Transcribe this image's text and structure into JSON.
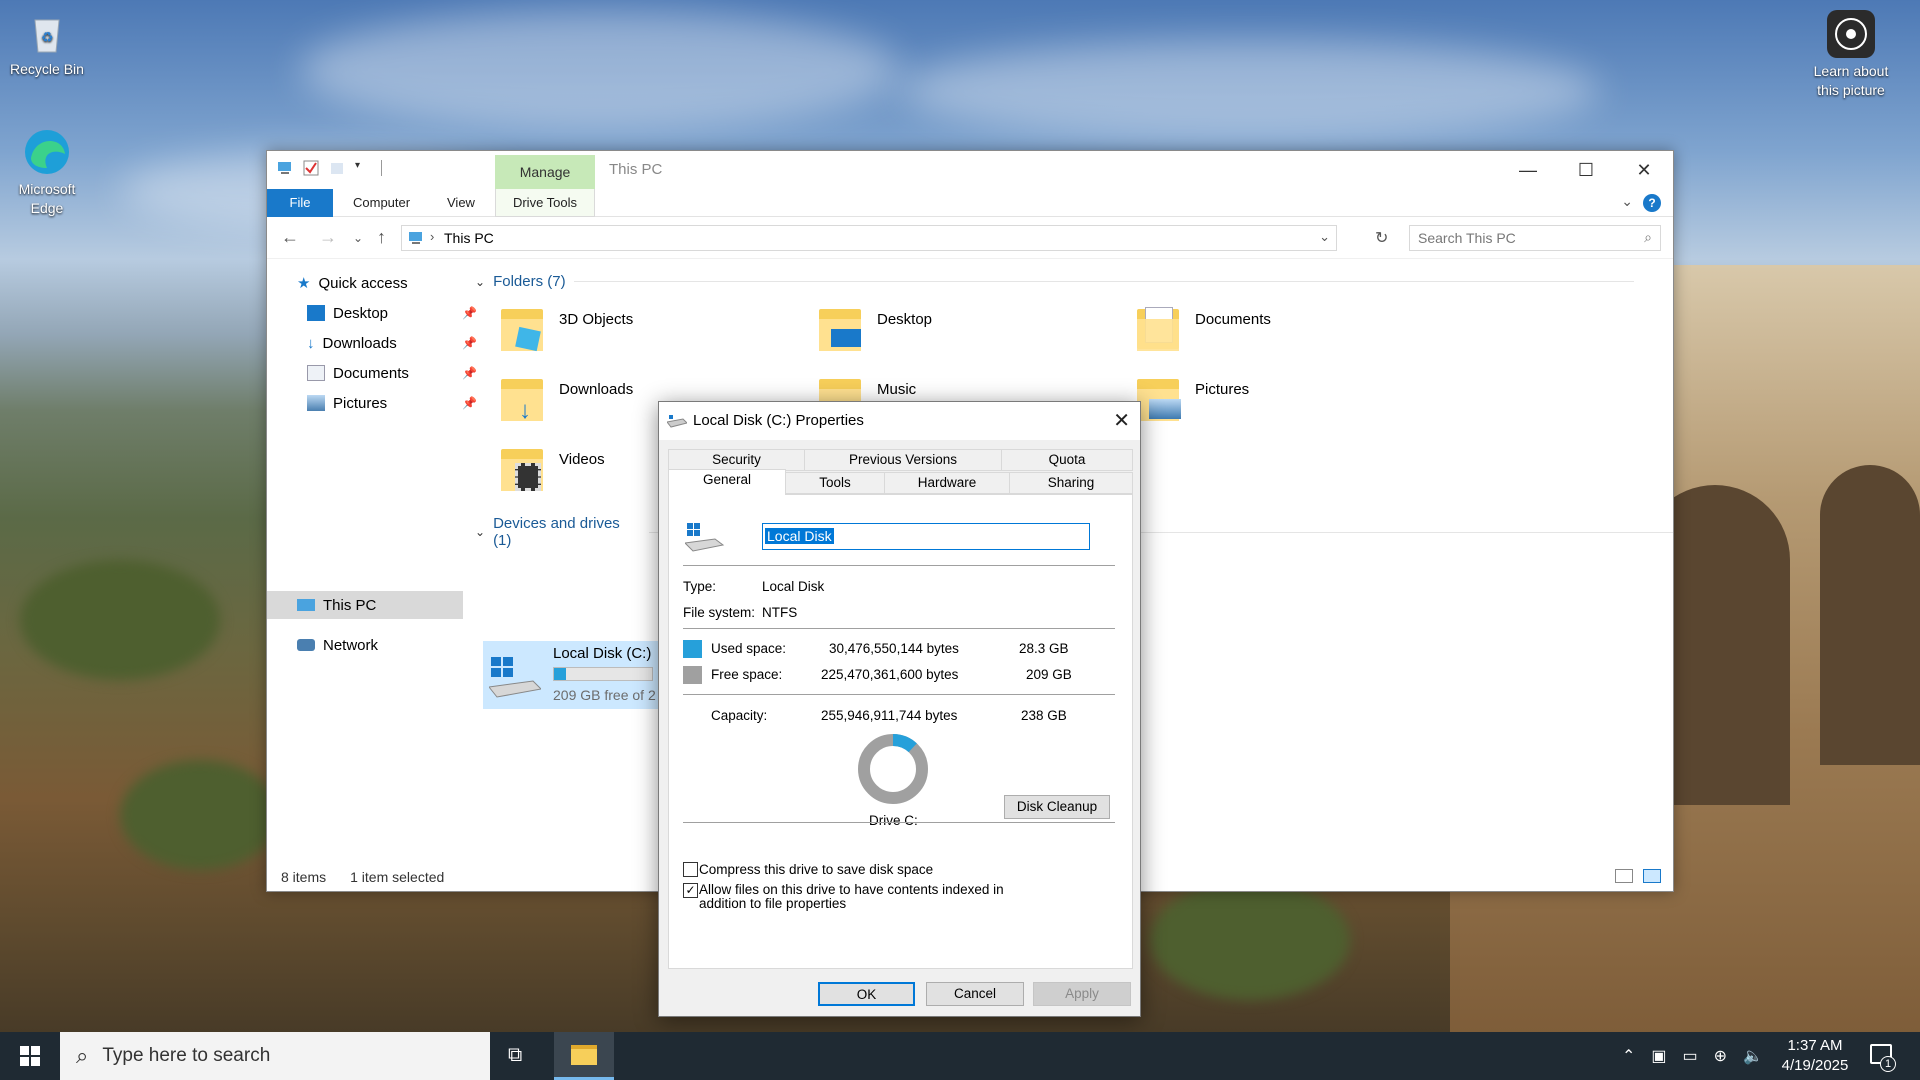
{
  "desktop": {
    "icons": [
      {
        "label": "Recycle Bin"
      },
      {
        "label": "Microsoft Edge"
      },
      {
        "label": "Learn about this picture"
      }
    ]
  },
  "explorer": {
    "title": "This PC",
    "manage_tab": "Manage",
    "ribbon_tabs": [
      "File",
      "Computer",
      "View",
      "Drive Tools"
    ],
    "address": "This PC",
    "search_placeholder": "Search This PC",
    "nav": {
      "quick_access": "Quick access",
      "items": [
        {
          "label": "Desktop"
        },
        {
          "label": "Downloads"
        },
        {
          "label": "Documents"
        },
        {
          "label": "Pictures"
        }
      ],
      "this_pc": "This PC",
      "network": "Network"
    },
    "folders_header": "Folders (7)",
    "folders": [
      "3D Objects",
      "Desktop",
      "Documents",
      "Downloads",
      "Music",
      "Pictures",
      "Videos"
    ],
    "devices_header": "Devices and drives (1)",
    "drive": {
      "name": "Local Disk (C:)",
      "free_text": "209 GB free of 2",
      "used_fraction": 0.12
    },
    "status": {
      "items": "8 items",
      "selected": "1 item selected"
    }
  },
  "dialog": {
    "title": "Local Disk (C:) Properties",
    "tabs_row1": [
      "Security",
      "Previous Versions",
      "Quota"
    ],
    "tabs_row2": [
      "General",
      "Tools",
      "Hardware",
      "Sharing"
    ],
    "name_value": "Local Disk",
    "type_label": "Type:",
    "type_value": "Local Disk",
    "fs_label": "File system:",
    "fs_value": "NTFS",
    "used_label": "Used space:",
    "used_bytes": "30,476,550,144 bytes",
    "used_gb": "28.3 GB",
    "free_label": "Free space:",
    "free_bytes": "225,470,361,600 bytes",
    "free_gb": "209 GB",
    "cap_label": "Capacity:",
    "cap_bytes": "255,946,911,744 bytes",
    "cap_gb": "238 GB",
    "drive_label": "Drive C:",
    "cleanup": "Disk Cleanup",
    "compress": "Compress this drive to save disk space",
    "index": "Allow files on this drive to have contents indexed in addition to file properties",
    "compress_checked": false,
    "index_checked": true,
    "ok": "OK",
    "cancel": "Cancel",
    "apply": "Apply",
    "used_fraction": 0.119,
    "colors": {
      "used": "#26a0da",
      "free": "#a0a0a0"
    }
  },
  "taskbar": {
    "search_placeholder": "Type here to search",
    "time": "1:37 AM",
    "date": "4/19/2025",
    "notifications": "1"
  }
}
